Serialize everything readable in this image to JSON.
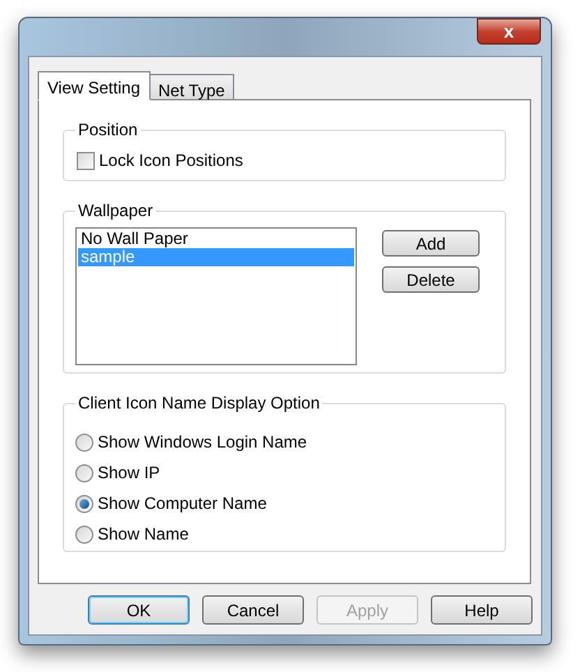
{
  "close_button": {
    "label": "x"
  },
  "tabs": [
    {
      "label": "View Setting",
      "selected": true
    },
    {
      "label": "Net Type",
      "selected": false
    }
  ],
  "position": {
    "title": "Position",
    "lock_icons": {
      "label": "Lock Icon Positions",
      "checked": false
    }
  },
  "wallpaper": {
    "title": "Wallpaper",
    "items": [
      {
        "label": "No Wall Paper",
        "selected": false
      },
      {
        "label": "sample",
        "selected": true
      }
    ],
    "buttons": [
      "Add",
      "Delete"
    ]
  },
  "display_option": {
    "title": "Client Icon Name Display Option",
    "options": [
      {
        "label": "Show Windows Login Name",
        "selected": false
      },
      {
        "label": "Show IP",
        "selected": false
      },
      {
        "label": "Show Computer Name",
        "selected": true
      },
      {
        "label": "Show Name",
        "selected": false
      }
    ]
  },
  "buttons": [
    {
      "label": "OK",
      "default": true,
      "disabled": false
    },
    {
      "label": "Cancel",
      "default": false,
      "disabled": false
    },
    {
      "label": "Apply",
      "default": false,
      "disabled": true
    },
    {
      "label": "Help",
      "default": false,
      "disabled": false
    }
  ]
}
